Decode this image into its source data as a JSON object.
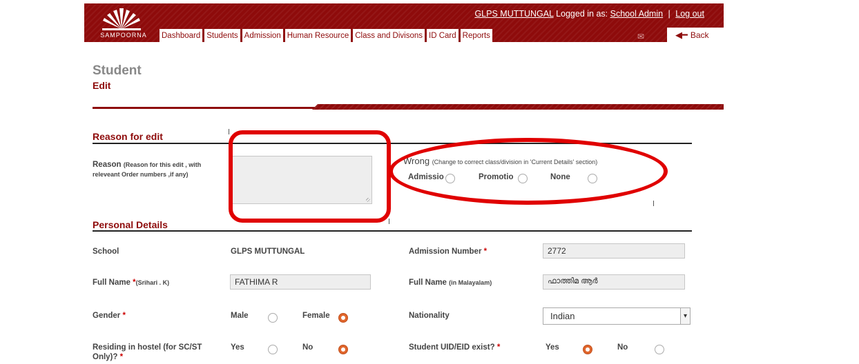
{
  "header": {
    "logo_text": "SAMPOORNA",
    "school_link": "GLPS MUTTUNGAL",
    "logged_in_text": "Logged in as:",
    "user_link": "School Admin",
    "separator": "|",
    "logout_link": "Log out",
    "nav": [
      "Dashboard",
      "Students",
      "Admission",
      "Human Resource",
      "Class and Divisons",
      "ID Card",
      "Reports"
    ],
    "back_label": "Back",
    "mail_icon": "mail-icon",
    "back_icon": "arrow-left-icon"
  },
  "page": {
    "title": "Student",
    "subtitle": "Edit"
  },
  "reason_section": {
    "title": "Reason for edit",
    "reason_label": "Reason",
    "reason_hint": "(Reason for this edit , with releveant Order numbers ,if any)",
    "reason_value": "",
    "wrong_label": "Wrong",
    "wrong_hint": "(Change to correct class/division in 'Current Details' section)",
    "options": [
      {
        "label": "Admissio",
        "checked": false
      },
      {
        "label": "Promotio",
        "checked": false
      },
      {
        "label": "None",
        "checked": false
      }
    ]
  },
  "personal": {
    "title": "Personal Details",
    "school_label": "School",
    "school_value": "GLPS MUTTUNGAL",
    "admission_label": "Admission Number",
    "admission_value": "2772",
    "fullname_label": "Full Name",
    "fullname_hint": "(Srihari . K)",
    "fullname_value": "FATHIMA R",
    "fullname_ml_label": "Full Name",
    "fullname_ml_hint": "(in Malayalam)",
    "fullname_ml_value": "ഫാത്തിമ ആർ",
    "gender_label": "Gender",
    "gender_male": "Male",
    "gender_female": "Female",
    "gender_selected": "Female",
    "nationality_label": "Nationality",
    "nationality_value": "Indian",
    "hostel_label": "Residing in hostel (for SC/ST Only)?",
    "hostel_yes": "Yes",
    "hostel_no": "No",
    "hostel_selected": "No",
    "uid_label": "Student UID/EID exist?",
    "uid_yes": "Yes",
    "uid_no": "No",
    "uid_selected": "Yes",
    "required_mark": "*"
  },
  "colors": {
    "brand": "#8e0b0b",
    "radio_checked": "#e0662c",
    "annotation": "#e00000"
  }
}
